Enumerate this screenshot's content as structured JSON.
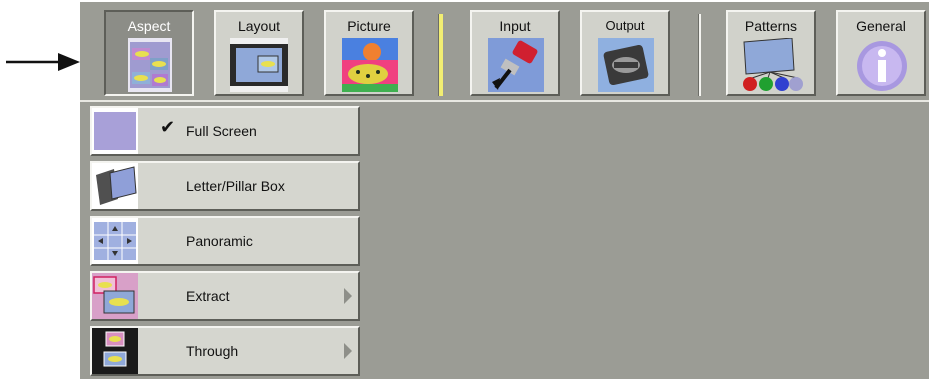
{
  "toolbar": {
    "aspect": "Aspect",
    "layout": "Layout",
    "picture": "Picture",
    "input": "Input",
    "output": "Output",
    "patterns": "Patterns",
    "general": "General"
  },
  "menu": {
    "items": [
      {
        "label": "Full Screen",
        "checked": true,
        "submenu": false
      },
      {
        "label": "Letter/Pillar Box",
        "checked": false,
        "submenu": false
      },
      {
        "label": "Panoramic",
        "checked": false,
        "submenu": false
      },
      {
        "label": "Extract",
        "checked": false,
        "submenu": true
      },
      {
        "label": "Through",
        "checked": false,
        "submenu": true
      }
    ],
    "check_glyph": "✔"
  },
  "colors": {
    "panel": "#9b9c95",
    "button_face": "#d1d2cb",
    "button_active": "#8c8d87",
    "separator_yellow": "#f2ee72"
  }
}
